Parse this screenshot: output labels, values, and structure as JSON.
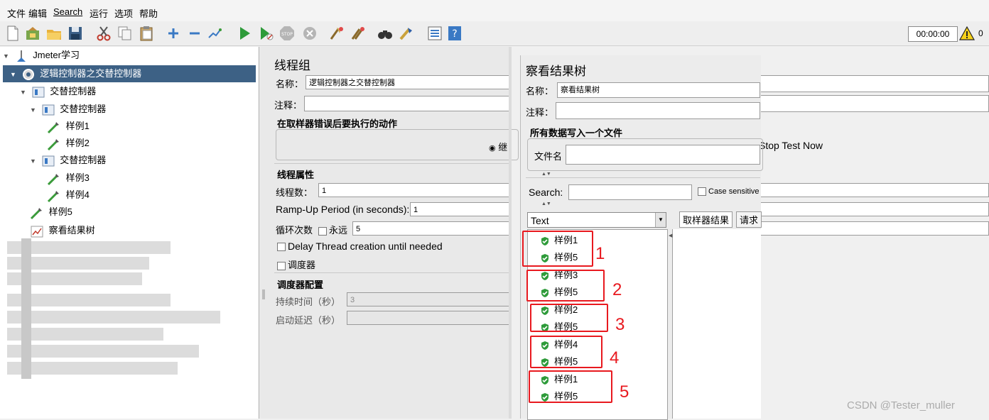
{
  "menu": {
    "items": [
      "文件",
      "编辑",
      "Search",
      "运行",
      "选项",
      "帮助"
    ]
  },
  "toolbar": {
    "timer": "00:00:00",
    "warning_count": "0",
    "icons": [
      "new-file-icon",
      "templates-icon",
      "open-icon",
      "save-icon",
      "cut-icon",
      "copy-icon",
      "paste-icon",
      "expand-icon",
      "collapse-icon",
      "toggle-icon",
      "start-icon",
      "start-no-pauses-icon",
      "stop-icon",
      "shutdown-icon",
      "clear-icon",
      "clear-all-icon",
      "search-icon",
      "reset-search-icon",
      "function-helper-icon",
      "help-icon"
    ]
  },
  "tree": {
    "root": "Jmeter学习",
    "selected": "逻辑控制器之交替控制器",
    "nodes": [
      {
        "label": "交替控制器"
      },
      {
        "label": "交替控制器"
      },
      {
        "label": "样例1"
      },
      {
        "label": "样例2"
      },
      {
        "label": "交替控制器"
      },
      {
        "label": "样例3"
      },
      {
        "label": "样例4"
      },
      {
        "label": "样例5"
      },
      {
        "label": "察看结果树"
      }
    ]
  },
  "thread_group": {
    "title": "线程组",
    "name_label": "名称：",
    "name_value": "逻辑控制器之交替控制器",
    "comment_label": "注释：",
    "on_error_title": "在取样器错误后要执行的动作",
    "continue_label": "继",
    "props_title": "线程属性",
    "threads_label": "线程数：",
    "threads_value": "1",
    "rampup_label": "Ramp-Up Period (in seconds):",
    "rampup_value": "1",
    "loop_label": "循环次数",
    "forever_label": "永远",
    "loop_value": "5",
    "delay_label": "Delay Thread creation until needed",
    "scheduler_label": "调度器",
    "scheduler_config_title": "调度器配置",
    "duration_label": "持续时间（秒）",
    "duration_value": "3",
    "startup_label": "启动延迟（秒）"
  },
  "results_tree": {
    "title": "察看结果树",
    "name_label": "名称：",
    "name_value": "察看结果树",
    "comment_label": "注释：",
    "file_section": "所有数据写入一个文件",
    "filename_label": "文件名",
    "search_label": "Search:",
    "case_label": "Case sensitive",
    "renderer": "Text",
    "tab1": "取样器结果",
    "tab2": "请求",
    "stop_text": "Stop Test Now",
    "results": [
      "样例1",
      "样例5",
      "样例3",
      "样例5",
      "样例2",
      "样例5",
      "样例4",
      "样例5",
      "样例1",
      "样例5"
    ],
    "annotations": [
      "1",
      "2",
      "3",
      "4",
      "5"
    ]
  },
  "watermark": "CSDN @Tester_muller",
  "colors": {
    "selection": "#3d6185",
    "annotation": "#e8191f",
    "success": "#2e9b3a"
  }
}
